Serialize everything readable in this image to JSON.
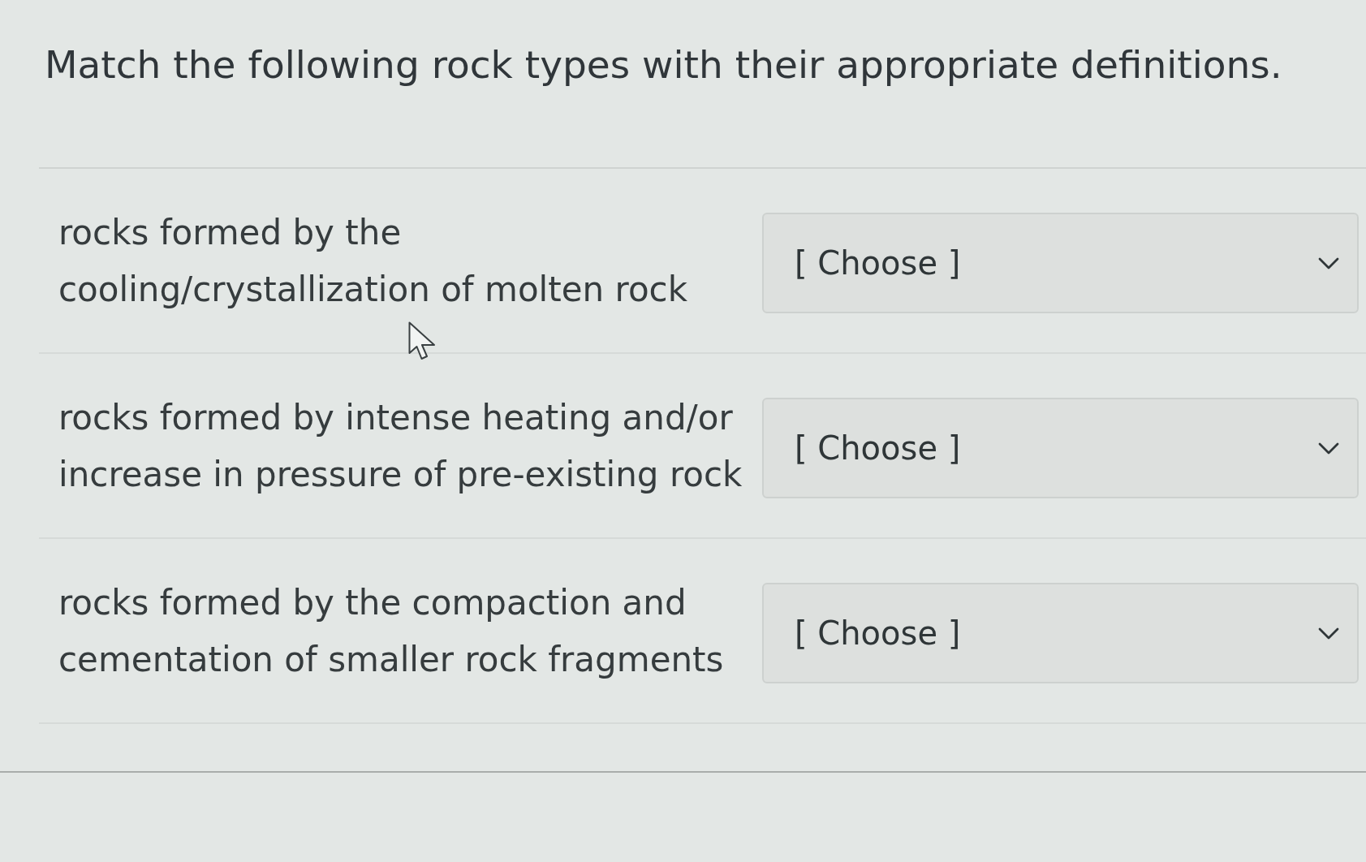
{
  "question": {
    "prompt": "Match the following rock types with their appropriate definitions."
  },
  "matches": [
    {
      "definition": "rocks formed by the cooling/crystallization of molten rock",
      "dropdown": {
        "value": "[ Choose ]"
      }
    },
    {
      "definition": "rocks formed by intense heating and/or increase in pressure of pre-existing rock",
      "dropdown": {
        "value": "[ Choose ]"
      }
    },
    {
      "definition": "rocks formed by the compaction and cementation of smaller rock fragments",
      "dropdown": {
        "value": "[ Choose ]"
      }
    }
  ]
}
